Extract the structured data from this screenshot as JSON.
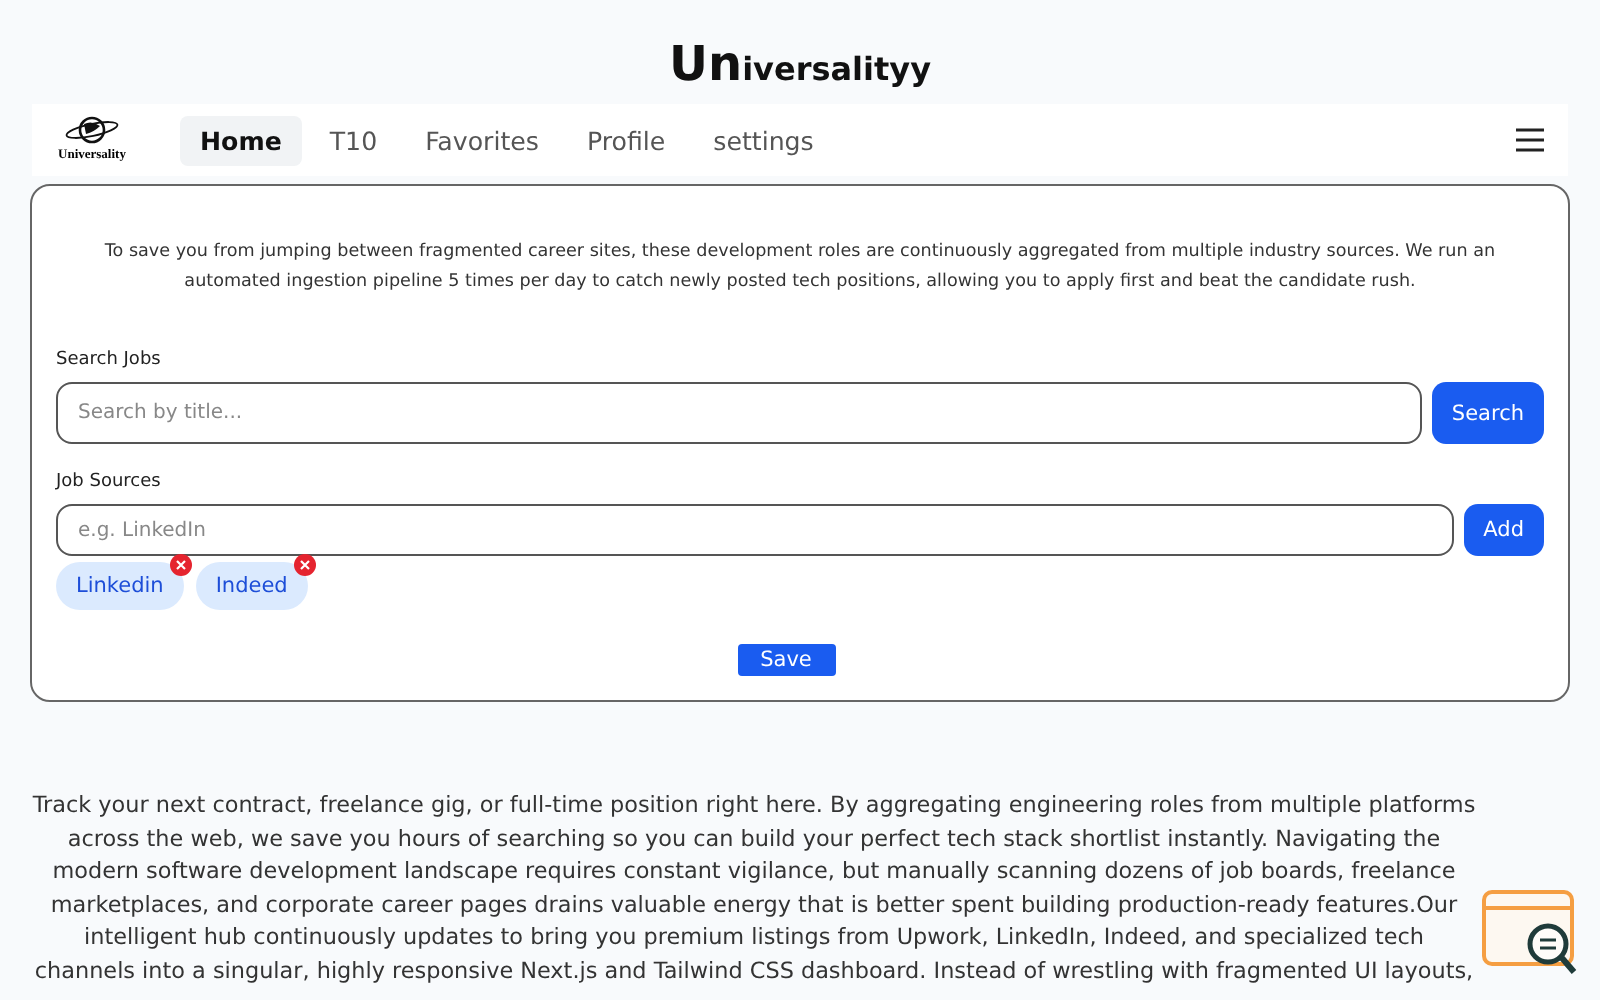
{
  "brand": {
    "lead": "Un",
    "rest": "iversalityy"
  },
  "nav": {
    "logo_text": "Universality",
    "tabs": [
      {
        "label": "Home",
        "selected": true
      },
      {
        "label": "T10",
        "selected": false
      },
      {
        "label": "Favorites",
        "selected": false
      },
      {
        "label": "Profile",
        "selected": false
      },
      {
        "label": "settings",
        "selected": false
      }
    ]
  },
  "card": {
    "intro": "To save you from jumping between fragmented career sites, these development roles are continuously aggregated from multiple industry sources. We run an automated ingestion pipeline 5 times per day to catch newly posted tech positions, allowing you to apply first and beat the candidate rush.",
    "search": {
      "label": "Search Jobs",
      "placeholder": "Search by title...",
      "button": "Search"
    },
    "sources": {
      "label": "Job Sources",
      "placeholder": "e.g. LinkedIn",
      "button": "Add",
      "chips": [
        {
          "label": "Linkedin"
        },
        {
          "label": "Indeed"
        }
      ]
    },
    "save": "Save"
  },
  "footer_text": "Track your next contract, freelance gig, or full-time position right here. By aggregating engineering roles from multiple platforms across the web, we save you hours of searching so you can build your perfect tech stack shortlist instantly. Navigating the modern software development landscape requires constant vigilance, but manually scanning dozens of job boards, freelance marketplaces, and corporate career pages drains valuable energy that is better spent building production-ready features.Our intelligent hub continuously updates to bring you premium listings from Upwork, LinkedIn, Indeed, and specialized tech channels into a singular, highly responsive Next.js and Tailwind CSS dashboard. Instead of wrestling with fragmented UI layouts,"
}
